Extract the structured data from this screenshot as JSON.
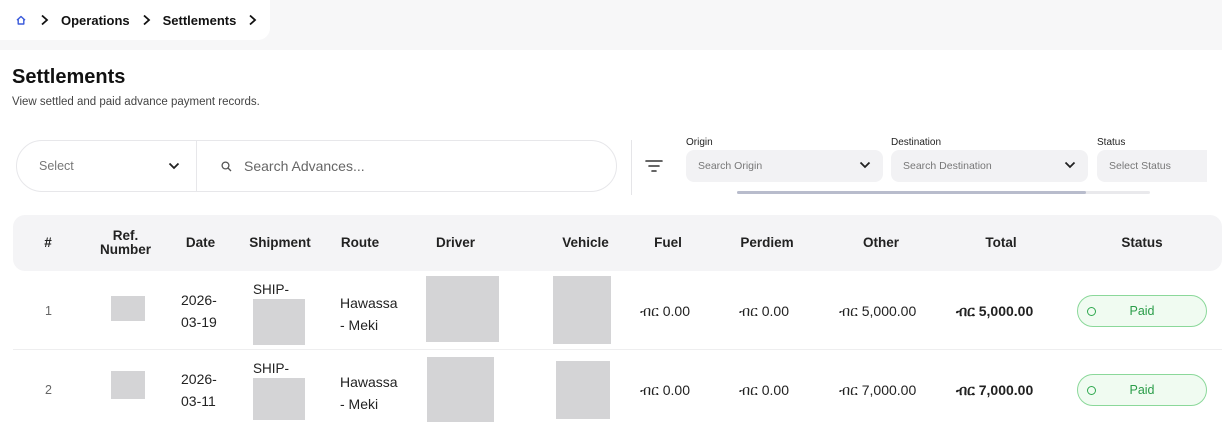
{
  "breadcrumb": {
    "home_icon": "home-icon",
    "separator_icon": "chevron-right-icon",
    "items": [
      "Operations",
      "Settlements"
    ]
  },
  "page": {
    "title": "Settlements",
    "subtitle": "View settled and paid advance payment records."
  },
  "search": {
    "select_label": "Select",
    "placeholder": "Search Advances..."
  },
  "filters": {
    "origin": {
      "label": "Origin",
      "placeholder": "Search Origin"
    },
    "destination": {
      "label": "Destination",
      "placeholder": "Search Destination"
    },
    "status": {
      "label": "Status",
      "placeholder": "Select Status"
    }
  },
  "table": {
    "columns": [
      "#",
      "Ref. Number",
      "Date",
      "Shipment",
      "Route",
      "Driver",
      "Vehicle",
      "Fuel",
      "Perdiem",
      "Other",
      "Total",
      "Status"
    ],
    "rows": [
      {
        "index": "1",
        "date_line1": "2026-",
        "date_line2": "03-19",
        "shipment_prefix": "SHIP-",
        "route_line1": "Hawassa",
        "route_line2": "- Meki",
        "fuel": "ብር 0.00",
        "perdiem": "ብር 0.00",
        "other": "ብር 5,000.00",
        "total": "ብር 5,000.00",
        "status": "Paid"
      },
      {
        "index": "2",
        "date_line1": "2026-",
        "date_line2": "03-11",
        "shipment_prefix": "SHIP-",
        "route_line1": "Hawassa",
        "route_line2": "- Meki",
        "fuel": "ብር 0.00",
        "perdiem": "ብር 0.00",
        "other": "ብር 7,000.00",
        "total": "ብር 7,000.00",
        "status": "Paid"
      }
    ]
  },
  "colors": {
    "paid_border": "#8bd89a",
    "paid_text": "#2a9d49",
    "header_bg": "#f4f4f6",
    "mask": "#d4d4d6"
  }
}
